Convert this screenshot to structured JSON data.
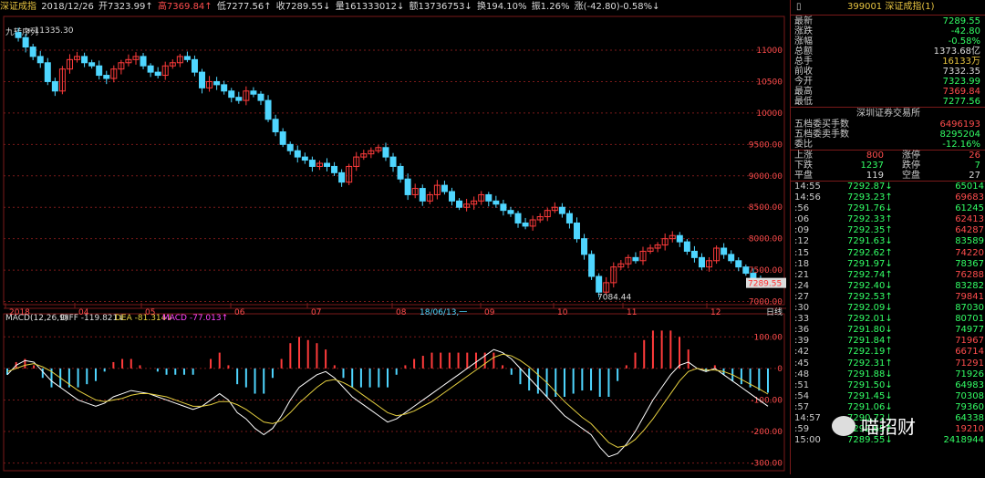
{
  "header": {
    "name": "深证成指",
    "date": "2018/12/26",
    "open": "开7323.99↑",
    "high": "高7369.84↑",
    "low": "低7277.56↑",
    "close": "收7289.55↓",
    "volume": "量161333012↓",
    "amount": "额13736753↓",
    "turnover": "换194.10%",
    "amplitude": "振1.26%",
    "change": "涨(-42.80)-0.58%↓"
  },
  "indicator_labels": {
    "nine_seq": "九转序列",
    "macd_title": "MACD(12,26,9)",
    "diff": "DIFF -119.821↓",
    "dea": "DEA -81.314↓",
    "macd": "MACD -77.013↑",
    "cursor_date": "18/06/13,一",
    "period": "日线"
  },
  "colors": {
    "up": "#ff3b3b",
    "down": "#4fd6ff",
    "diff": "#ffffff",
    "dea": "#e6d040",
    "grid": "#7a1a1a",
    "background": "#000000"
  },
  "chart_data": [
    {
      "type": "candlestick",
      "title": "深证成指",
      "x_tick_labels": [
        "2018",
        "04",
        "05",
        "06",
        "07",
        "08",
        "09",
        "10",
        "11",
        "12"
      ],
      "y_tick_labels": [
        "11000",
        "10500",
        "10000",
        "9500.00",
        "9000.00",
        "8500.00",
        "8000.00",
        "7500.00",
        "7000.00"
      ],
      "ylim": [
        6950,
        11450
      ],
      "annotations": [
        {
          "label": "11335.30",
          "value": 11335.3
        },
        {
          "label": "7084.44",
          "value": 7084.44
        },
        {
          "label": "7289.55",
          "value": 7289.55
        }
      ],
      "close_path": [
        11280,
        11200,
        11050,
        10900,
        10800,
        10500,
        10350,
        10700,
        10850,
        10900,
        10800,
        10750,
        10600,
        10550,
        10700,
        10800,
        10850,
        10900,
        10750,
        10650,
        10600,
        10750,
        10800,
        10900,
        10850,
        10650,
        10400,
        10500,
        10450,
        10350,
        10250,
        10200,
        10350,
        10300,
        10200,
        9900,
        9700,
        9500,
        9400,
        9300,
        9250,
        9150,
        9200,
        9150,
        9050,
        8900,
        9150,
        9300,
        9350,
        9400,
        9450,
        9300,
        9150,
        8950,
        8700,
        8800,
        8600,
        8700,
        8850,
        8750,
        8600,
        8500,
        8550,
        8600,
        8700,
        8600,
        8550,
        8450,
        8400,
        8250,
        8200,
        8300,
        8350,
        8450,
        8500,
        8400,
        8250,
        8000,
        7750,
        7400,
        7150,
        7300,
        7550,
        7600,
        7700,
        7650,
        7800,
        7850,
        7900,
        8000,
        8050,
        7950,
        7800,
        7700,
        7550,
        7650,
        7850,
        7750,
        7650,
        7550,
        7450,
        7350,
        7300,
        7289.55
      ]
    },
    {
      "type": "bar",
      "title": "MACD(12,26,9)",
      "y_tick_labels": [
        "100.00",
        "0",
        "-100.00",
        "-200.00",
        "-300.00"
      ],
      "ylim": [
        -330,
        150
      ],
      "series": [
        {
          "name": "DIFF",
          "values": [
            -20,
            10,
            25,
            20,
            -10,
            -40,
            -60,
            -80,
            -100,
            -110,
            -120,
            -110,
            -90,
            -80,
            -70,
            -75,
            -80,
            -90,
            -100,
            -110,
            -120,
            -130,
            -120,
            -100,
            -80,
            -100,
            -140,
            -160,
            -190,
            -210,
            -190,
            -150,
            -100,
            -60,
            -40,
            -20,
            -10,
            -30,
            -60,
            -90,
            -110,
            -130,
            -150,
            -170,
            -160,
            -140,
            -120,
            -100,
            -80,
            -60,
            -40,
            -20,
            0,
            20,
            40,
            60,
            50,
            30,
            0,
            -30,
            -60,
            -90,
            -120,
            -150,
            -170,
            -190,
            -210,
            -250,
            -280,
            -270,
            -240,
            -200,
            -150,
            -100,
            -60,
            -20,
            10,
            20,
            0,
            -10,
            0,
            -20,
            -40,
            -60,
            -80,
            -100,
            -119.821
          ]
        },
        {
          "name": "DEA",
          "values": [
            -10,
            0,
            10,
            15,
            5,
            -10,
            -30,
            -50,
            -70,
            -85,
            -100,
            -105,
            -100,
            -95,
            -85,
            -80,
            -80,
            -85,
            -90,
            -100,
            -110,
            -120,
            -120,
            -115,
            -105,
            -105,
            -115,
            -130,
            -150,
            -170,
            -175,
            -165,
            -140,
            -110,
            -85,
            -60,
            -40,
            -35,
            -45,
            -60,
            -80,
            -100,
            -120,
            -140,
            -150,
            -145,
            -135,
            -120,
            -105,
            -85,
            -65,
            -45,
            -25,
            -5,
            15,
            35,
            45,
            40,
            25,
            5,
            -20,
            -45,
            -75,
            -105,
            -130,
            -155,
            -175,
            -205,
            -235,
            -250,
            -245,
            -225,
            -195,
            -160,
            -120,
            -80,
            -40,
            -10,
            0,
            -5,
            -5,
            -10,
            -20,
            -35,
            -50,
            -65,
            -81.314
          ]
        },
        {
          "name": "MACD",
          "values": [
            -77.013
          ]
        }
      ]
    }
  ],
  "side_panel": {
    "title": "399001 深证成指(1)",
    "icon_glyph": "▯",
    "rows": [
      {
        "k": "最新",
        "v": "7289.55",
        "c": "#33ff66"
      },
      {
        "k": "涨跌",
        "v": "-42.80",
        "c": "#33ff66"
      },
      {
        "k": "涨幅",
        "v": "-0.58%",
        "c": "#33ff66"
      },
      {
        "k": "总额",
        "v": "1373.68亿",
        "c": "#dddddd"
      },
      {
        "k": "总手",
        "v": "16133万",
        "c": "#e6c340"
      },
      {
        "k": "前收",
        "v": "7332.35",
        "c": "#dddddd"
      },
      {
        "k": "今开",
        "v": "7323.99",
        "c": "#33ff66"
      },
      {
        "k": "最高",
        "v": "7369.84",
        "c": "#ff4d4d"
      },
      {
        "k": "最低",
        "v": "7277.56",
        "c": "#33ff66"
      }
    ],
    "exchange": "深圳证券交易所",
    "orders": [
      {
        "k": "五档委买手数",
        "v": "6496193",
        "c": "#ff4d4d"
      },
      {
        "k": "五档委卖手数",
        "v": "8295204",
        "c": "#33ff66"
      },
      {
        "k": "委比",
        "v": "-12.16%",
        "c": "#33ff66"
      }
    ],
    "breadth": [
      {
        "k": "上涨",
        "v1": "800",
        "k2": "涨停",
        "v2": "26",
        "c": "#ff4d4d"
      },
      {
        "k": "下跌",
        "v1": "1237",
        "k2": "跌停",
        "v2": "7",
        "c": "#33ff66"
      },
      {
        "k": "平盘",
        "v1": "119",
        "k2": "空盘",
        "v2": "27",
        "c": "#dddddd"
      }
    ],
    "ticks": [
      {
        "t": "14:55",
        "p": "7292.87↓",
        "v": "65014"
      },
      {
        "t": "14:56",
        "p": "7293.23↑",
        "v": "69683"
      },
      {
        "t": ":56",
        "p": "7291.76↓",
        "v": "61245"
      },
      {
        "t": ":06",
        "p": "7292.33↑",
        "v": "62413"
      },
      {
        "t": ":09",
        "p": "7292.35↑",
        "v": "64287"
      },
      {
        "t": ":12",
        "p": "7291.63↓",
        "v": "83589"
      },
      {
        "t": ":15",
        "p": "7292.62↑",
        "v": "74220"
      },
      {
        "t": ":18",
        "p": "7291.97↓",
        "v": "78367"
      },
      {
        "t": ":21",
        "p": "7292.74↑",
        "v": "76288"
      },
      {
        "t": ":24",
        "p": "7292.40↓",
        "v": "83282"
      },
      {
        "t": ":27",
        "p": "7292.53↑",
        "v": "79841"
      },
      {
        "t": ":30",
        "p": "7292.09↓",
        "v": "87030"
      },
      {
        "t": ":33",
        "p": "7292.01↓",
        "v": "80701"
      },
      {
        "t": ":36",
        "p": "7291.80↓",
        "v": "74977"
      },
      {
        "t": ":39",
        "p": "7291.84↑",
        "v": "71967"
      },
      {
        "t": ":42",
        "p": "7292.19↑",
        "v": "66714"
      },
      {
        "t": ":45",
        "p": "7292.31↑",
        "v": "71291"
      },
      {
        "t": ":48",
        "p": "7291.88↓",
        "v": "71926"
      },
      {
        "t": ":51",
        "p": "7291.50↓",
        "v": "64983"
      },
      {
        "t": ":54",
        "p": "7291.45↓",
        "v": "70308"
      },
      {
        "t": ":57",
        "p": "7291.06↓",
        "v": "79360"
      },
      {
        "t": "14:57",
        "p": "7290.72↓",
        "v": "64338"
      },
      {
        "t": ":59",
        "p": "7292.65↑",
        "v": "19210"
      },
      {
        "t": "15:00",
        "p": "7289.55↓",
        "v": "2418944"
      }
    ]
  },
  "watermark": {
    "text": "喵招财"
  }
}
